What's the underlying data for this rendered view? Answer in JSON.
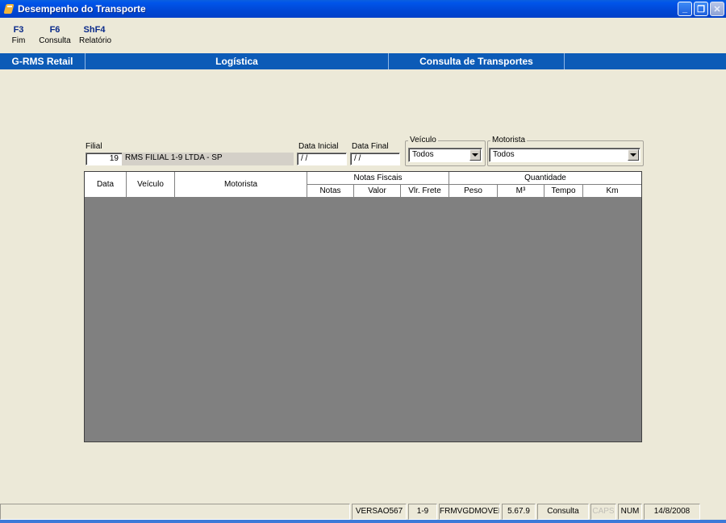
{
  "window": {
    "title": "Desempenho do Transporte"
  },
  "fkeys": [
    {
      "key": "F3",
      "label": "Fim"
    },
    {
      "key": "F6",
      "label": "Consulta"
    },
    {
      "key": "ShF4",
      "label": "Relatório"
    }
  ],
  "header": {
    "app": "G-RMS Retail",
    "module": "Logística",
    "screen": "Consulta de Transportes"
  },
  "form": {
    "filial_label": "Filial",
    "filial_code": "19",
    "filial_name": "RMS FILIAL 1-9 LTDA - SP",
    "data_inicial_label": "Data Inicial",
    "data_inicial_value": "/ /",
    "data_final_label": "Data Final",
    "data_final_value": "/ /",
    "veiculo_label": "Veículo",
    "veiculo_value": "Todos",
    "motorista_label": "Motorista",
    "motorista_value": "Todos"
  },
  "grid": {
    "columns": {
      "data": "Data",
      "veiculo": "Veículo",
      "motorista": "Motorista",
      "notas_fiscais": "Notas Fiscais",
      "notas": "Notas",
      "valor": "Valor",
      "vlr_frete": "Vlr. Frete",
      "quantidade": "Quantidade",
      "peso": "Peso",
      "m3": "M³",
      "tempo": "Tempo",
      "km": "Km"
    }
  },
  "status": {
    "versao": "VERSAO567",
    "filial": "1-9",
    "form": "FRMVGDMOVEI",
    "build": "5.67.9",
    "mode": "Consulta",
    "caps": "CAPS",
    "num": "NUM",
    "date": "14/8/2008"
  }
}
